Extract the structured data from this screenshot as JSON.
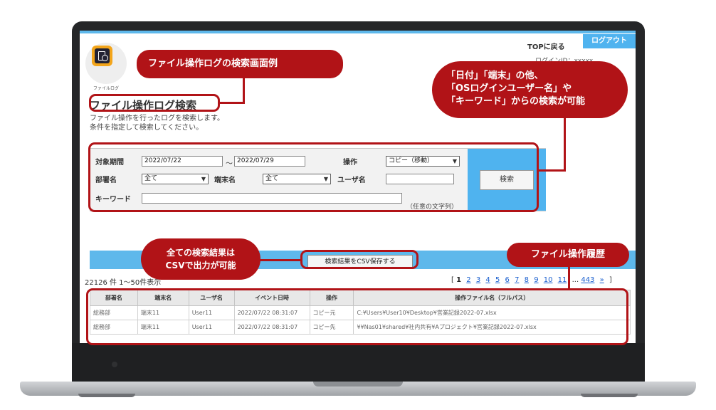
{
  "header": {
    "top_link": "TOPに戻る",
    "logout": "ログアウト",
    "login_id": "ログインID：xxxxx"
  },
  "app": {
    "icon": "file-log-icon",
    "label": "ファイルログ"
  },
  "page": {
    "title": "ファイル操作ログ検索",
    "desc_line1": "ファイル操作を行ったログを検索します。",
    "desc_line2": "条件を指定して検索してください。"
  },
  "form": {
    "period_label": "対象期間",
    "date_from": "2022/07/22",
    "tilde": "～",
    "date_to": "2022/07/29",
    "operation_label": "操作",
    "operation_value": "コピー（移動）",
    "dept_label": "部署名",
    "dept_value": "全て",
    "terminal_label": "端末名",
    "terminal_value": "全て",
    "user_label": "ユーザ名",
    "user_value": "",
    "keyword_label": "キーワード",
    "keyword_value": "",
    "keyword_hint": "（任意の文字列）",
    "search_button": "検索"
  },
  "results": {
    "csv_button": "検索結果をCSV保存する",
    "count_text": "22126 件 1～50件表示",
    "pager": {
      "open": "[",
      "current": "1",
      "pages": [
        "2",
        "3",
        "4",
        "5",
        "6",
        "7",
        "8",
        "9",
        "10",
        "11"
      ],
      "ellipsis": "...",
      "last": "443",
      "next": "»",
      "close": "]"
    },
    "columns": [
      "部署名",
      "端末名",
      "ユーザ名",
      "イベント日時",
      "操作",
      "操作ファイル名（フルパス）"
    ],
    "rows": [
      [
        "総務部",
        "端末11",
        "User11",
        "2022/07/22 08:31:07",
        "コピー元",
        "C:¥Users¥User10¥Desktop¥営業記録2022-07.xlsx"
      ],
      [
        "総務部",
        "端末11",
        "User11",
        "2022/07/22 08:31:07",
        "コピー先",
        "¥¥Nas01¥shared¥社内共有¥Aプロジェクト¥営業記録2022-07.xlsx"
      ]
    ]
  },
  "annotations": {
    "title_callout": "ファイル操作ログの検索画面例",
    "filter_callout_line1": "「日付」「端末」の他、",
    "filter_callout_line2": "「OSログインユーザー名」や",
    "filter_callout_line3": "「キーワード」からの検索が可能",
    "csv_callout_line1": "全ての検索結果は",
    "csv_callout_line2": "CSVで出力が可能",
    "history_callout": "ファイル操作履歴",
    "color": "#b11317"
  }
}
